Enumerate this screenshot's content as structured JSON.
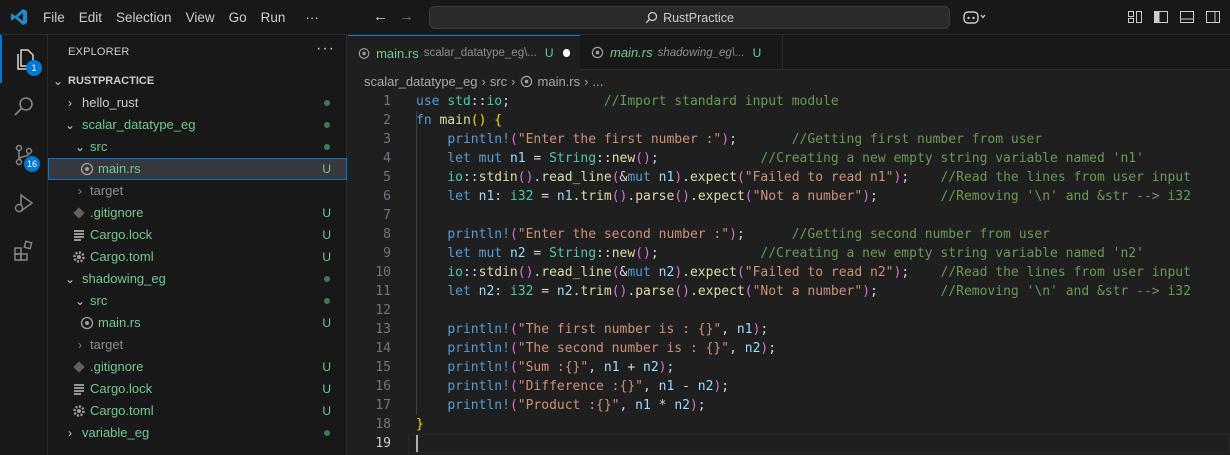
{
  "titlebar": {
    "menu": [
      "File",
      "Edit",
      "Selection",
      "View",
      "Go",
      "Run",
      "···"
    ],
    "search": "RustPractice"
  },
  "activity_bar": {
    "explorer_badge": "1",
    "scm_badge": "16"
  },
  "sidebar": {
    "title": "EXPLORER",
    "more": "···",
    "root": "RUSTPRACTICE",
    "items": [
      {
        "label": "hello_rust"
      },
      {
        "label": "scalar_datatype_eg"
      },
      {
        "label": "src"
      },
      {
        "label": "main.rs",
        "status": "U"
      },
      {
        "label": "target"
      },
      {
        "label": ".gitignore",
        "status": "U"
      },
      {
        "label": "Cargo.lock",
        "status": "U"
      },
      {
        "label": "Cargo.toml",
        "status": "U"
      },
      {
        "label": "shadowing_eg"
      },
      {
        "label": "src"
      },
      {
        "label": "main.rs",
        "status": "U"
      },
      {
        "label": "target"
      },
      {
        "label": ".gitignore",
        "status": "U"
      },
      {
        "label": "Cargo.lock",
        "status": "U"
      },
      {
        "label": "Cargo.toml",
        "status": "U"
      },
      {
        "label": "variable_eg"
      }
    ]
  },
  "tabs": [
    {
      "name": "main.rs",
      "desc": "scalar_datatype_eg\\...",
      "status": "U"
    },
    {
      "name": "main.rs",
      "desc": "shadowing_eg\\...",
      "status": "U"
    }
  ],
  "breadcrumb": [
    "scalar_datatype_eg",
    "src",
    "main.rs",
    "..."
  ],
  "code": {
    "line_numbers": [
      "1",
      "2",
      "3",
      "4",
      "5",
      "6",
      "7",
      "8",
      "9",
      "10",
      "11",
      "12",
      "13",
      "14",
      "15",
      "16",
      "17",
      "18",
      "19"
    ],
    "lines": [
      [
        {
          "c": "k",
          "t": "use"
        },
        {
          "c": "p",
          "t": " "
        },
        {
          "c": "t",
          "t": "std"
        },
        {
          "c": "p",
          "t": "::"
        },
        {
          "c": "t",
          "t": "io"
        },
        {
          "c": "p",
          "t": ";            "
        },
        {
          "c": "c",
          "t": "//Import standard input module"
        }
      ],
      [
        {
          "c": "k",
          "t": "fn"
        },
        {
          "c": "p",
          "t": " "
        },
        {
          "c": "f",
          "t": "main"
        },
        {
          "c": "b1",
          "t": "()"
        },
        {
          "c": "p",
          "t": " "
        },
        {
          "c": "b1",
          "t": "{"
        }
      ],
      [
        {
          "c": "p",
          "t": "    "
        },
        {
          "c": "k",
          "t": "println!"
        },
        {
          "c": "b2",
          "t": "("
        },
        {
          "c": "s",
          "t": "\"Enter the first number :\""
        },
        {
          "c": "b2",
          "t": ")"
        },
        {
          "c": "p",
          "t": ";       "
        },
        {
          "c": "c",
          "t": "//Getting first number from user"
        }
      ],
      [
        {
          "c": "p",
          "t": "    "
        },
        {
          "c": "k",
          "t": "let"
        },
        {
          "c": "p",
          "t": " "
        },
        {
          "c": "k",
          "t": "mut"
        },
        {
          "c": "p",
          "t": " "
        },
        {
          "c": "v",
          "t": "n1"
        },
        {
          "c": "p",
          "t": " = "
        },
        {
          "c": "t",
          "t": "String"
        },
        {
          "c": "p",
          "t": "::"
        },
        {
          "c": "f",
          "t": "new"
        },
        {
          "c": "b2",
          "t": "()"
        },
        {
          "c": "p",
          "t": ";             "
        },
        {
          "c": "c",
          "t": "//Creating a new empty string variable named 'n1'"
        }
      ],
      [
        {
          "c": "p",
          "t": "    "
        },
        {
          "c": "t",
          "t": "io"
        },
        {
          "c": "p",
          "t": "::"
        },
        {
          "c": "f",
          "t": "stdin"
        },
        {
          "c": "b2",
          "t": "()"
        },
        {
          "c": "p",
          "t": "."
        },
        {
          "c": "f",
          "t": "read_line"
        },
        {
          "c": "b2",
          "t": "("
        },
        {
          "c": "p",
          "t": "&"
        },
        {
          "c": "k",
          "t": "mut"
        },
        {
          "c": "p",
          "t": " "
        },
        {
          "c": "v",
          "t": "n1"
        },
        {
          "c": "b2",
          "t": ")"
        },
        {
          "c": "p",
          "t": "."
        },
        {
          "c": "f",
          "t": "expect"
        },
        {
          "c": "b2",
          "t": "("
        },
        {
          "c": "s",
          "t": "\"Failed to read n1\""
        },
        {
          "c": "b2",
          "t": ")"
        },
        {
          "c": "p",
          "t": ";    "
        },
        {
          "c": "c",
          "t": "//Read the lines from user input"
        }
      ],
      [
        {
          "c": "p",
          "t": "    "
        },
        {
          "c": "k",
          "t": "let"
        },
        {
          "c": "p",
          "t": " "
        },
        {
          "c": "v",
          "t": "n1"
        },
        {
          "c": "p",
          "t": ": "
        },
        {
          "c": "t",
          "t": "i32"
        },
        {
          "c": "p",
          "t": " = "
        },
        {
          "c": "v",
          "t": "n1"
        },
        {
          "c": "p",
          "t": "."
        },
        {
          "c": "f",
          "t": "trim"
        },
        {
          "c": "b2",
          "t": "()"
        },
        {
          "c": "p",
          "t": "."
        },
        {
          "c": "f",
          "t": "parse"
        },
        {
          "c": "b2",
          "t": "()"
        },
        {
          "c": "p",
          "t": "."
        },
        {
          "c": "f",
          "t": "expect"
        },
        {
          "c": "b2",
          "t": "("
        },
        {
          "c": "s",
          "t": "\"Not a number\""
        },
        {
          "c": "b2",
          "t": ")"
        },
        {
          "c": "p",
          "t": ";        "
        },
        {
          "c": "c",
          "t": "//Removing '\\n' and &str --> i32"
        }
      ],
      [],
      [
        {
          "c": "p",
          "t": "    "
        },
        {
          "c": "k",
          "t": "println!"
        },
        {
          "c": "b2",
          "t": "("
        },
        {
          "c": "s",
          "t": "\"Enter the second number :\""
        },
        {
          "c": "b2",
          "t": ")"
        },
        {
          "c": "p",
          "t": ";      "
        },
        {
          "c": "c",
          "t": "//Getting second number from user"
        }
      ],
      [
        {
          "c": "p",
          "t": "    "
        },
        {
          "c": "k",
          "t": "let"
        },
        {
          "c": "p",
          "t": " "
        },
        {
          "c": "k",
          "t": "mut"
        },
        {
          "c": "p",
          "t": " "
        },
        {
          "c": "v",
          "t": "n2"
        },
        {
          "c": "p",
          "t": " = "
        },
        {
          "c": "t",
          "t": "String"
        },
        {
          "c": "p",
          "t": "::"
        },
        {
          "c": "f",
          "t": "new"
        },
        {
          "c": "b2",
          "t": "()"
        },
        {
          "c": "p",
          "t": ";             "
        },
        {
          "c": "c",
          "t": "//Creating a new empty string variable named 'n2'"
        }
      ],
      [
        {
          "c": "p",
          "t": "    "
        },
        {
          "c": "t",
          "t": "io"
        },
        {
          "c": "p",
          "t": "::"
        },
        {
          "c": "f",
          "t": "stdin"
        },
        {
          "c": "b2",
          "t": "()"
        },
        {
          "c": "p",
          "t": "."
        },
        {
          "c": "f",
          "t": "read_line"
        },
        {
          "c": "b2",
          "t": "("
        },
        {
          "c": "p",
          "t": "&"
        },
        {
          "c": "k",
          "t": "mut"
        },
        {
          "c": "p",
          "t": " "
        },
        {
          "c": "v",
          "t": "n2"
        },
        {
          "c": "b2",
          "t": ")"
        },
        {
          "c": "p",
          "t": "."
        },
        {
          "c": "f",
          "t": "expect"
        },
        {
          "c": "b2",
          "t": "("
        },
        {
          "c": "s",
          "t": "\"Failed to read n2\""
        },
        {
          "c": "b2",
          "t": ")"
        },
        {
          "c": "p",
          "t": ";    "
        },
        {
          "c": "c",
          "t": "//Read the lines from user input"
        }
      ],
      [
        {
          "c": "p",
          "t": "    "
        },
        {
          "c": "k",
          "t": "let"
        },
        {
          "c": "p",
          "t": " "
        },
        {
          "c": "v",
          "t": "n2"
        },
        {
          "c": "p",
          "t": ": "
        },
        {
          "c": "t",
          "t": "i32"
        },
        {
          "c": "p",
          "t": " = "
        },
        {
          "c": "v",
          "t": "n2"
        },
        {
          "c": "p",
          "t": "."
        },
        {
          "c": "f",
          "t": "trim"
        },
        {
          "c": "b2",
          "t": "()"
        },
        {
          "c": "p",
          "t": "."
        },
        {
          "c": "f",
          "t": "parse"
        },
        {
          "c": "b2",
          "t": "()"
        },
        {
          "c": "p",
          "t": "."
        },
        {
          "c": "f",
          "t": "expect"
        },
        {
          "c": "b2",
          "t": "("
        },
        {
          "c": "s",
          "t": "\"Not a number\""
        },
        {
          "c": "b2",
          "t": ")"
        },
        {
          "c": "p",
          "t": ";        "
        },
        {
          "c": "c",
          "t": "//Removing '\\n' and &str --> i32"
        }
      ],
      [],
      [
        {
          "c": "p",
          "t": "    "
        },
        {
          "c": "k",
          "t": "println!"
        },
        {
          "c": "b2",
          "t": "("
        },
        {
          "c": "s",
          "t": "\"The first number is : {}\""
        },
        {
          "c": "p",
          "t": ", "
        },
        {
          "c": "v",
          "t": "n1"
        },
        {
          "c": "b2",
          "t": ")"
        },
        {
          "c": "p",
          "t": ";"
        }
      ],
      [
        {
          "c": "p",
          "t": "    "
        },
        {
          "c": "k",
          "t": "println!"
        },
        {
          "c": "b2",
          "t": "("
        },
        {
          "c": "s",
          "t": "\"The second number is : {}\""
        },
        {
          "c": "p",
          "t": ", "
        },
        {
          "c": "v",
          "t": "n2"
        },
        {
          "c": "b2",
          "t": ")"
        },
        {
          "c": "p",
          "t": ";"
        }
      ],
      [
        {
          "c": "p",
          "t": "    "
        },
        {
          "c": "k",
          "t": "println!"
        },
        {
          "c": "b2",
          "t": "("
        },
        {
          "c": "s",
          "t": "\"Sum :{}\""
        },
        {
          "c": "p",
          "t": ", "
        },
        {
          "c": "v",
          "t": "n1"
        },
        {
          "c": "p",
          "t": " + "
        },
        {
          "c": "v",
          "t": "n2"
        },
        {
          "c": "b2",
          "t": ")"
        },
        {
          "c": "p",
          "t": ";"
        }
      ],
      [
        {
          "c": "p",
          "t": "    "
        },
        {
          "c": "k",
          "t": "println!"
        },
        {
          "c": "b2",
          "t": "("
        },
        {
          "c": "s",
          "t": "\"Difference :{}\""
        },
        {
          "c": "p",
          "t": ", "
        },
        {
          "c": "v",
          "t": "n1"
        },
        {
          "c": "p",
          "t": " - "
        },
        {
          "c": "v",
          "t": "n2"
        },
        {
          "c": "b2",
          "t": ")"
        },
        {
          "c": "p",
          "t": ";"
        }
      ],
      [
        {
          "c": "p",
          "t": "    "
        },
        {
          "c": "k",
          "t": "println!"
        },
        {
          "c": "b2",
          "t": "("
        },
        {
          "c": "s",
          "t": "\"Product :{}\""
        },
        {
          "c": "p",
          "t": ", "
        },
        {
          "c": "v",
          "t": "n1"
        },
        {
          "c": "p",
          "t": " * "
        },
        {
          "c": "v",
          "t": "n2"
        },
        {
          "c": "b2",
          "t": ")"
        },
        {
          "c": "p",
          "t": ";"
        }
      ],
      [
        {
          "c": "b1",
          "t": "}"
        }
      ],
      []
    ]
  }
}
